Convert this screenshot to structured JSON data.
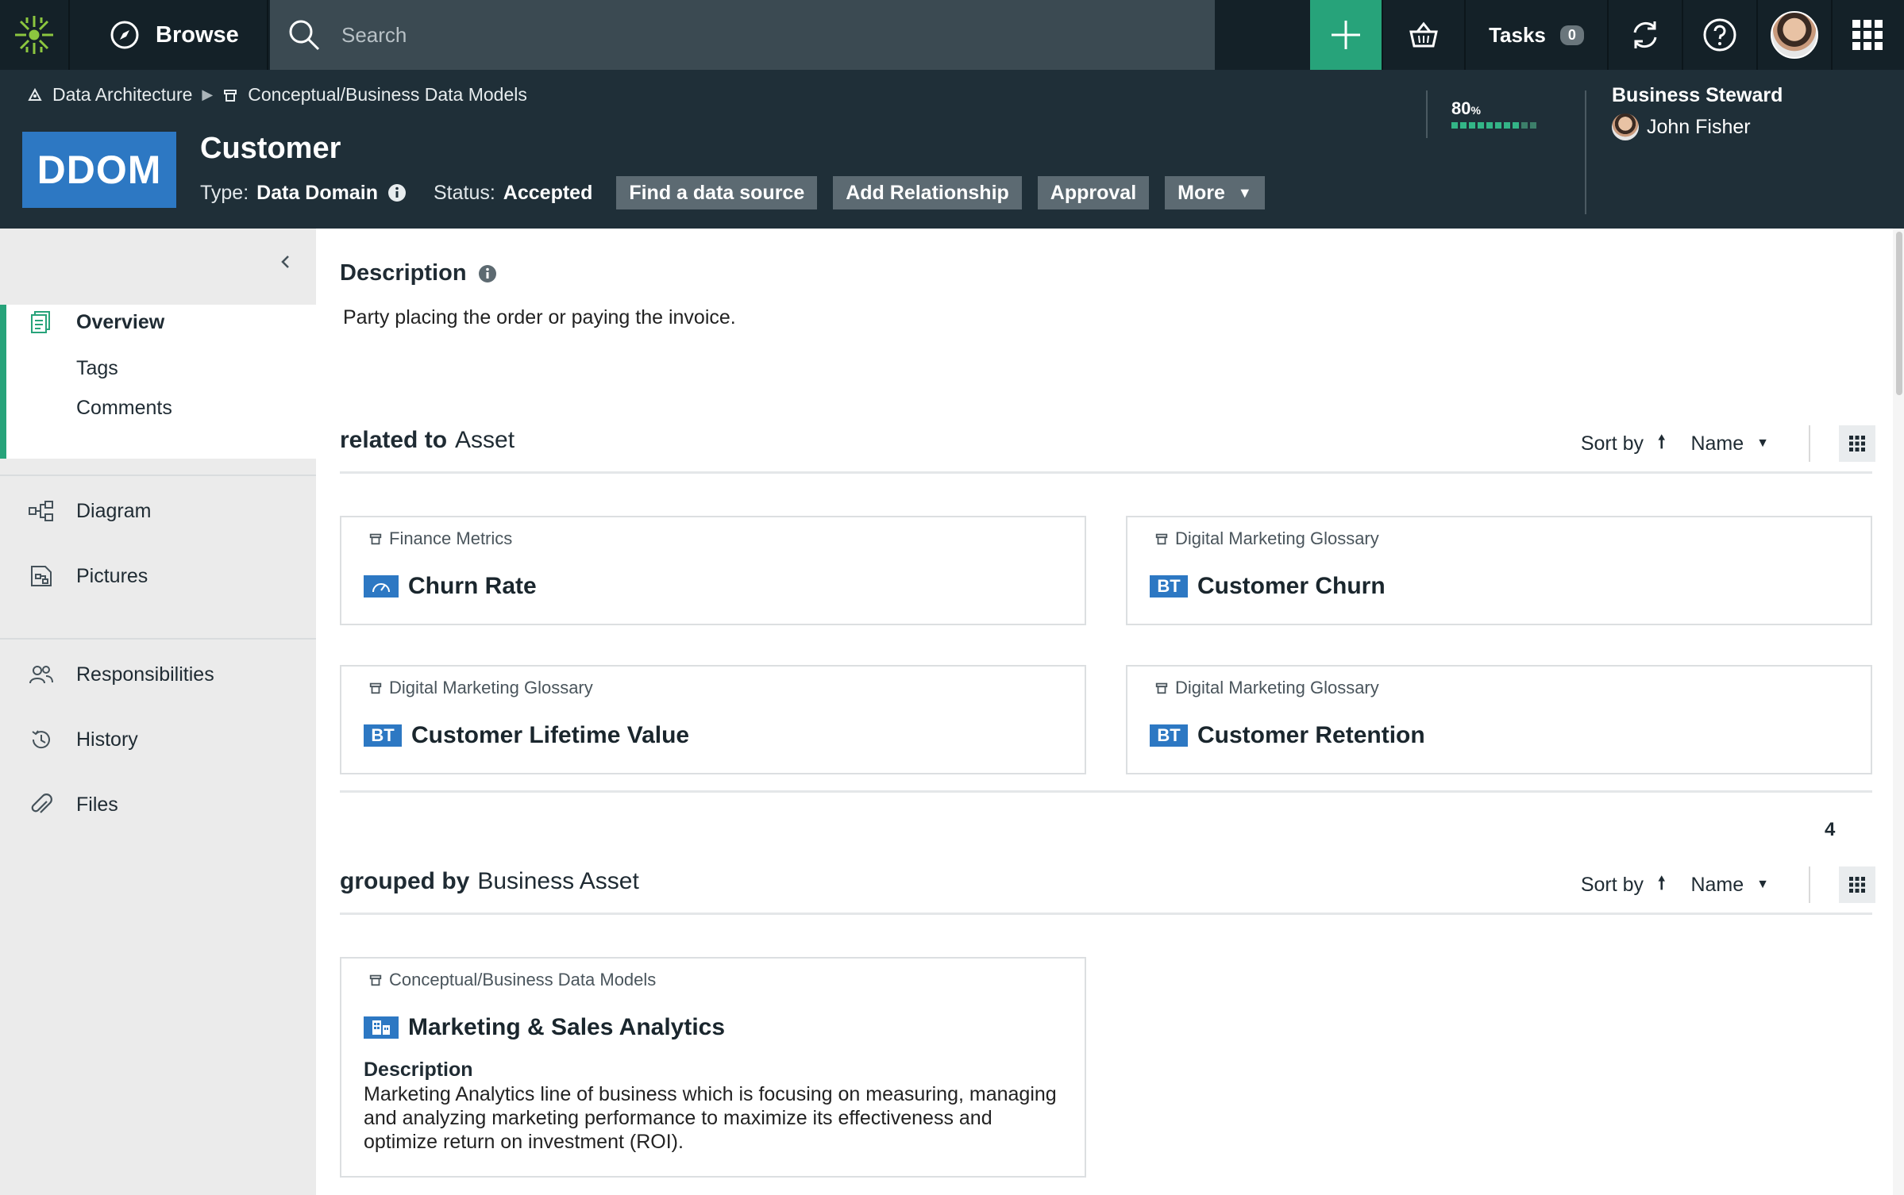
{
  "topbar": {
    "browse_label": "Browse",
    "search_placeholder": "Search",
    "tasks_label": "Tasks",
    "tasks_count": "0"
  },
  "header": {
    "breadcrumb": [
      "Data Architecture",
      "Conceptual/Business Data Models"
    ],
    "type_badge": "DDOM",
    "asset_name": "Customer",
    "type_label": "Type:",
    "type_value": "Data Domain",
    "status_label": "Status:",
    "status_value": "Accepted",
    "actions": [
      "Find a data source",
      "Add Relationship",
      "Approval",
      "More"
    ],
    "progress_text": "80",
    "progress_unit": "%",
    "progress_value": 0.8,
    "steward_role": "Business Steward",
    "steward_name": "John Fisher"
  },
  "sidebar": {
    "items": [
      {
        "label": "Overview",
        "icon": "overview-icon"
      },
      {
        "label": "Tags"
      },
      {
        "label": "Comments"
      },
      {
        "label": "Diagram",
        "icon": "diagram-icon"
      },
      {
        "label": "Pictures",
        "icon": "pictures-icon"
      },
      {
        "label": "Responsibilities",
        "icon": "responsibilities-icon"
      },
      {
        "label": "History",
        "icon": "history-icon"
      },
      {
        "label": "Files",
        "icon": "paperclip-icon"
      }
    ]
  },
  "main": {
    "description_title": "Description",
    "description_text": "Party placing the order or paying the invoice.",
    "related": {
      "relation": "related to",
      "target": "Asset",
      "sort_label": "Sort by",
      "sort_field": "Name",
      "cards": [
        {
          "domain": "Finance Metrics",
          "name": "Churn Rate",
          "badge": ""
        },
        {
          "domain": "Digital Marketing Glossary",
          "name": "Customer Churn",
          "badge": "BT"
        },
        {
          "domain": "Digital Marketing Glossary",
          "name": "Customer Lifetime Value",
          "badge": "BT"
        },
        {
          "domain": "Digital Marketing Glossary",
          "name": "Customer Retention",
          "badge": "BT"
        }
      ],
      "count": "4"
    },
    "grouped": {
      "relation": "grouped by",
      "target": "Business Asset",
      "sort_label": "Sort by",
      "sort_field": "Name",
      "cards": [
        {
          "domain": "Conceptual/Business Data Models",
          "name": "Marketing & Sales Analytics",
          "desc_label": "Description",
          "desc": "Marketing Analytics line of business which is focusing on measuring, managing and analyzing marketing performance to maximize its effectiveness and optimize return on investment (ROI)."
        }
      ]
    }
  },
  "colors": {
    "accent_green": "#27a37a",
    "brand_blue": "#2d78c3",
    "topbar_bg": "#142128",
    "header_bg": "#1f2f38"
  }
}
